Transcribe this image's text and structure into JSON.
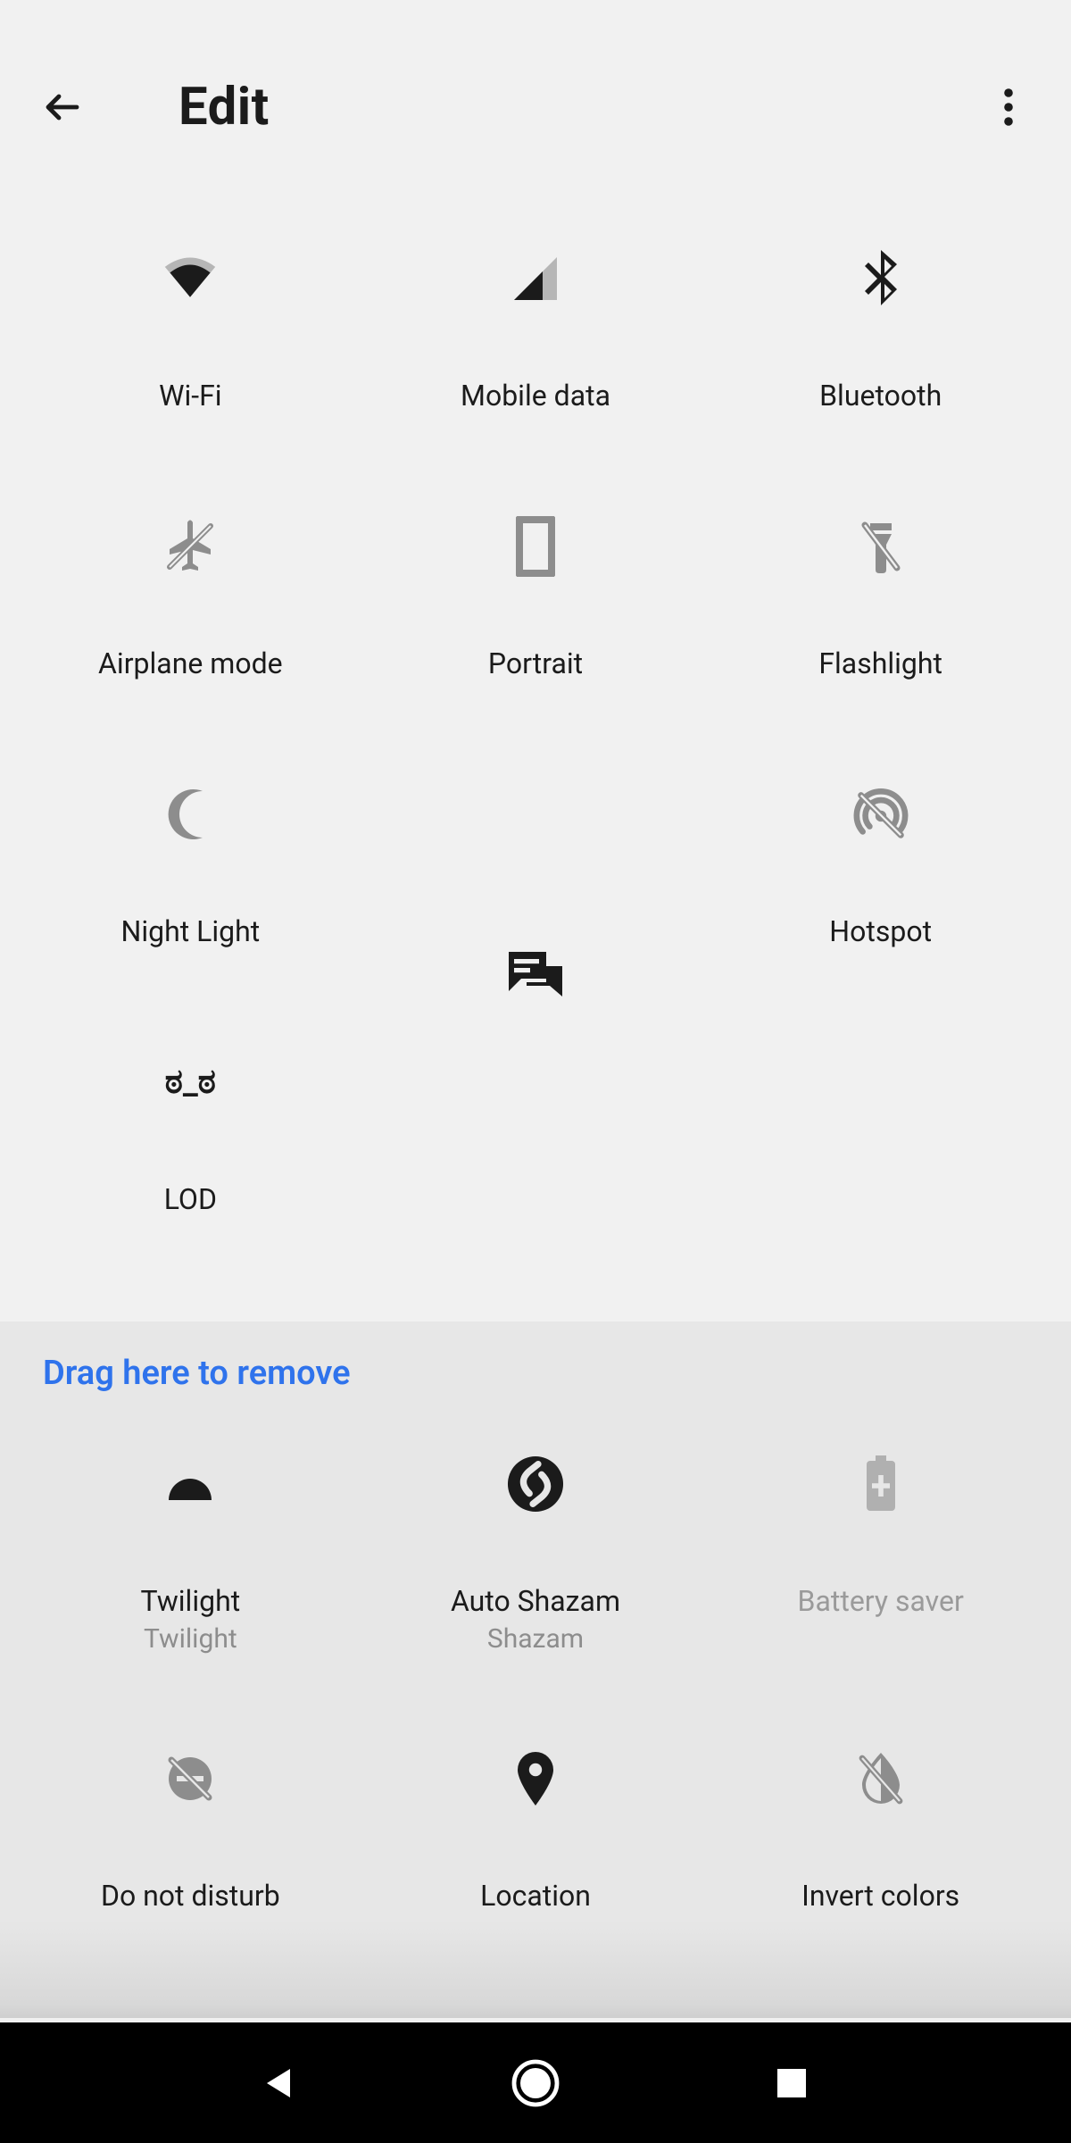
{
  "appbar": {
    "title": "Edit"
  },
  "active_tiles": [
    {
      "id": "wifi",
      "label": "Wi-Fi"
    },
    {
      "id": "mobile",
      "label": "Mobile data"
    },
    {
      "id": "bluetooth",
      "label": "Bluetooth"
    },
    {
      "id": "airplane",
      "label": "Airplane mode"
    },
    {
      "id": "portrait",
      "label": "Portrait"
    },
    {
      "id": "flashlight",
      "label": "Flashlight"
    },
    {
      "id": "nightlight",
      "label": "Night Light"
    },
    {
      "id": "chat",
      "label": ""
    },
    {
      "id": "hotspot",
      "label": "Hotspot"
    },
    {
      "id": "lod",
      "label": "LOD"
    }
  ],
  "remove_hint": "Drag here to remove",
  "removed_tiles": [
    {
      "id": "twilight",
      "label": "Twilight",
      "sublabel": "Twilight"
    },
    {
      "id": "shazam",
      "label": "Auto Shazam",
      "sublabel": "Shazam"
    },
    {
      "id": "battery",
      "label": "Battery saver"
    },
    {
      "id": "dnd",
      "label": "Do not disturb"
    },
    {
      "id": "location",
      "label": "Location"
    },
    {
      "id": "invert",
      "label": "Invert colors"
    }
  ]
}
